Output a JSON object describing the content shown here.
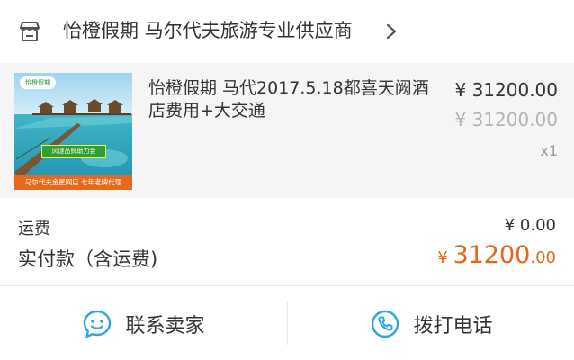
{
  "shop": {
    "name": "怡橙假期 马尔代夫旅游专业供应商",
    "icon": "store-icon",
    "chevron": "chevron-right-icon"
  },
  "item": {
    "title": "怡橙假期 马代2017.5.18都喜天阙酒店费用+大交通",
    "price": "¥ 31200.00",
    "original_price": "¥ 31200.00",
    "quantity": "x1",
    "thumbnail": {
      "badge": "怡橙假期",
      "green_label": "风谜品牌助力金",
      "caption": "马尔代夫金星网店 七年老牌代理"
    }
  },
  "summary": {
    "shipping_label": "运费",
    "shipping_value": "¥ 0.00",
    "total_label": "实付款（含运费)",
    "total_currency": "¥ ",
    "total_integer": "31200",
    "total_decimal": ".00"
  },
  "actions": {
    "contact_seller": "联系卖家",
    "call_phone": "拨打电话"
  },
  "colors": {
    "accent": "#e5641c",
    "icon_blue": "#29a8e0",
    "item_bg": "#f5f5f5"
  }
}
